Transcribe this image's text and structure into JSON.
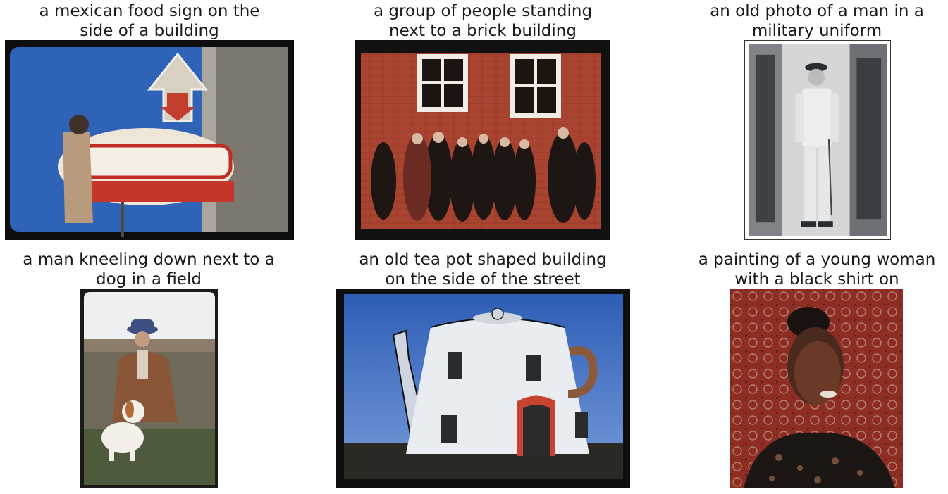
{
  "grid": {
    "items": [
      {
        "caption_line1": "a mexican food sign on the",
        "caption_line2": "side of a building",
        "image_subject": "neon-sign-photo"
      },
      {
        "caption_line1": "a group of people standing",
        "caption_line2": "next to a brick building",
        "image_subject": "group-photo"
      },
      {
        "caption_line1": "an old photo of a man in a",
        "caption_line2": "military uniform",
        "image_subject": "soldier-portrait-photo"
      },
      {
        "caption_line1": "a man kneeling down next to a",
        "caption_line2": "dog in a field",
        "image_subject": "man-with-dog-photo"
      },
      {
        "caption_line1": "an old tea pot shaped building",
        "caption_line2": "on the side of the street",
        "image_subject": "teapot-building-photo"
      },
      {
        "caption_line1": "a painting of a young woman",
        "caption_line2": "with a black shirt on",
        "image_subject": "woman-portrait-painting"
      }
    ]
  }
}
